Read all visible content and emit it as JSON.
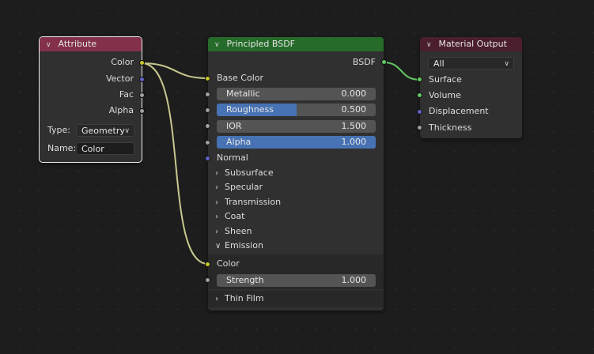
{
  "colors": {
    "attribute_header": "#83314a",
    "bsdf_header": "#266b2a",
    "output_header": "#4a1e2c",
    "wire_yellow": "#c7c78f",
    "wire_green": "#63c763",
    "accent_fill": "#4772b3"
  },
  "attribute_node": {
    "title": "Attribute",
    "outputs": [
      {
        "label": "Color",
        "socket": "yellow"
      },
      {
        "label": "Vector",
        "socket": "purple"
      },
      {
        "label": "Fac",
        "socket": "grey"
      },
      {
        "label": "Alpha",
        "socket": "grey"
      }
    ],
    "type_label": "Type:",
    "type_value": "Geometry",
    "name_label": "Name:",
    "name_value": "Color"
  },
  "bsdf_node": {
    "title": "Principled BSDF",
    "output_label": "BSDF",
    "base_color_label": "Base Color",
    "metallic": {
      "label": "Metallic",
      "value": "0.000",
      "fraction": 0.0
    },
    "roughness": {
      "label": "Roughness",
      "value": "0.500",
      "fraction": 0.5
    },
    "ior": {
      "label": "IOR",
      "value": "1.500",
      "fraction": 0.0
    },
    "alpha": {
      "label": "Alpha",
      "value": "1.000",
      "fraction": 1.0
    },
    "normal_label": "Normal",
    "panels": [
      "Subsurface",
      "Specular",
      "Transmission",
      "Coat",
      "Sheen"
    ],
    "emission_panel": "Emission",
    "emission_color_label": "Color",
    "emission_strength": {
      "label": "Strength",
      "value": "1.000",
      "fraction": 0.0
    },
    "thin_film_panel": "Thin Film"
  },
  "output_node": {
    "title": "Material Output",
    "target_value": "All",
    "inputs": [
      {
        "label": "Surface",
        "socket": "green"
      },
      {
        "label": "Volume",
        "socket": "green"
      },
      {
        "label": "Displacement",
        "socket": "purple"
      },
      {
        "label": "Thickness",
        "socket": "grey"
      }
    ]
  }
}
